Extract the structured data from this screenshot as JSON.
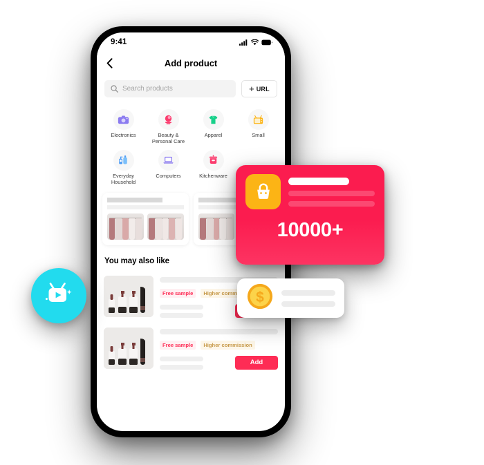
{
  "phone": {
    "status_bar": {
      "time": "9:41",
      "signal_icon": "cellular-signal-icon",
      "wifi_icon": "wifi-icon",
      "battery_icon": "battery-icon"
    },
    "nav": {
      "back_icon": "chevron-left-icon",
      "title": "Add product"
    },
    "search": {
      "icon": "search-icon",
      "placeholder": "Search products",
      "url_button": {
        "plus": "+",
        "label": "URL",
        "icon": "plus-icon"
      }
    },
    "categories": [
      {
        "label": "Electronics",
        "icon": "camera-icon",
        "color": "#8b7bf0"
      },
      {
        "label": "Beauty & Personal Care",
        "icon": "cosmetics-icon",
        "color": "#fb3c6e"
      },
      {
        "label": "Apparel",
        "icon": "tshirt-icon",
        "color": "#18d08a"
      },
      {
        "label": "Small",
        "icon": "television-icon",
        "color": "#fcb415"
      },
      {
        "label": "Everyday Household",
        "icon": "bottles-icon",
        "color": "#4f9df5"
      },
      {
        "label": "Computers",
        "icon": "laptop-icon",
        "color": "#8b7bf0"
      },
      {
        "label": "Kitchenware",
        "icon": "cooking-pot-icon",
        "color": "#fb3c6e"
      }
    ],
    "promo_cards": [
      {
        "image_alt": "clothing-rack-image",
        "thumbs": 2
      },
      {
        "image_alt": "clothing-rack-image",
        "thumbs": 2
      }
    ],
    "you_may_also_like": {
      "title": "You may also like",
      "products": [
        {
          "thumb": "cosmetic-bottles-image",
          "badges": [
            {
              "label": "Free sample",
              "color": "#fe2c55"
            },
            {
              "label": "Higher commission",
              "color": "#c79a4a"
            }
          ],
          "add_label": "Add"
        },
        {
          "thumb": "cosmetic-bottles-image",
          "badges": [
            {
              "label": "Free sample",
              "color": "#fe2c55"
            },
            {
              "label": "Higher commission",
              "color": "#c79a4a"
            }
          ],
          "add_label": "Add"
        }
      ]
    }
  },
  "floating": {
    "pink_card": {
      "icon": "shopping-bag-icon",
      "icon_tile_color": "#fcb415",
      "background_color": "#fb1c4f",
      "count": "10000+"
    },
    "white_card": {
      "icon": "dollar-coin-icon",
      "icon_color": "#fcb415"
    },
    "teal_bubble": {
      "icon": "tv-play-icon",
      "background_color": "#22dbee"
    }
  },
  "theme": {
    "accent_pink": "#fe2c55",
    "accent_yellow": "#fcb415",
    "accent_teal": "#22dbee"
  }
}
